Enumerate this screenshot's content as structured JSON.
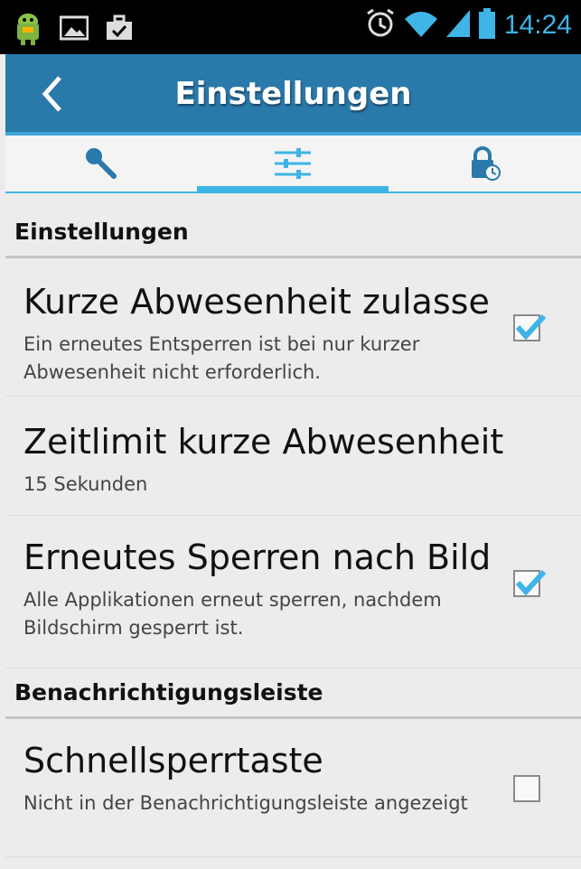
{
  "status_bar": {
    "time": "14:24",
    "left_icons": [
      "android-icon",
      "image-icon",
      "briefcase-icon"
    ],
    "right_icons": [
      "alarm-icon",
      "wifi-icon",
      "signal-icon",
      "battery-icon"
    ]
  },
  "action_bar": {
    "title": "Einstellungen"
  },
  "tabs": [
    {
      "name": "key-icon",
      "active": false
    },
    {
      "name": "sliders-icon",
      "active": true
    },
    {
      "name": "lock-icon",
      "active": false
    }
  ],
  "sections": [
    {
      "header": "Einstellungen",
      "items": [
        {
          "title": "Kurze Abwesenheit zulassen",
          "summary": "Ein erneutes Entsperren ist bei nur kurzer Abwesenheit nicht erforderlich.",
          "checked": true
        },
        {
          "title": "Zeitlimit kurze Abwesenheit",
          "summary": "15 Sekunden"
        },
        {
          "title": "Erneutes Sperren nach Bildschirmsperre",
          "summary": "Alle Applikationen erneut sperren, nachdem Bildschirm gesperrt ist.",
          "checked": true
        }
      ]
    },
    {
      "header": "Benachrichtigungsleiste",
      "items": [
        {
          "title": "Schnellsperrtaste",
          "summary": "Nicht in der Benachrichtigungsleiste angezeigt",
          "checked": false
        }
      ]
    }
  ],
  "colors": {
    "accent": "#3fb4e6",
    "action_bar": "#2a79ab",
    "background": "#ececec"
  }
}
